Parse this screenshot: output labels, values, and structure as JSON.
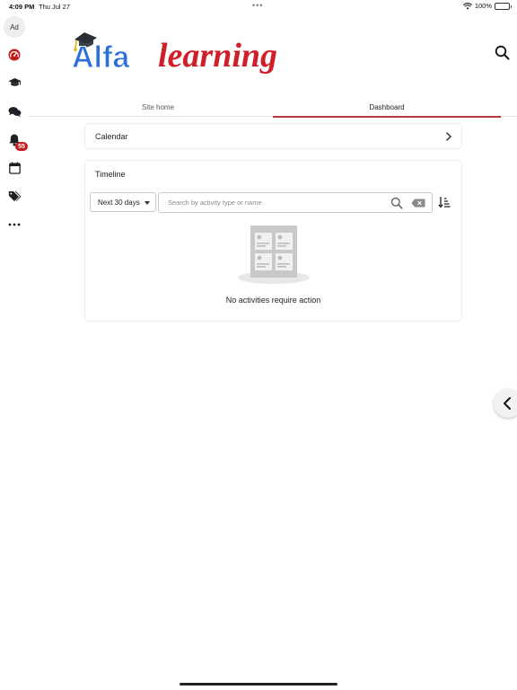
{
  "status_bar": {
    "time": "4:09 PM",
    "date": "Thu Jul 27",
    "battery": "100%"
  },
  "rail": {
    "avatar_initials": "Ad",
    "notifications_badge": "55",
    "icons": [
      "dashboard-gauge-icon",
      "graduation-cap-icon",
      "messages-icon",
      "bell-icon",
      "calendar-icon",
      "tags-icon",
      "more-icon"
    ]
  },
  "header": {
    "logo_text_alfa": "Alfa",
    "logo_text_learning": "learning"
  },
  "tabs": [
    {
      "label": "Site home",
      "active": false
    },
    {
      "label": "Dashboard",
      "active": true
    }
  ],
  "calendar_card": {
    "title": "Calendar"
  },
  "timeline_card": {
    "title": "Timeline",
    "range_selected": "Next 30 days",
    "search_placeholder": "Search by activity type or name",
    "empty_message": "No activities require action"
  },
  "colors": {
    "accent": "#b33a3a",
    "badge": "#c31c1c",
    "logo_blue": "#2a6fdb",
    "logo_red": "#d11f2a"
  }
}
